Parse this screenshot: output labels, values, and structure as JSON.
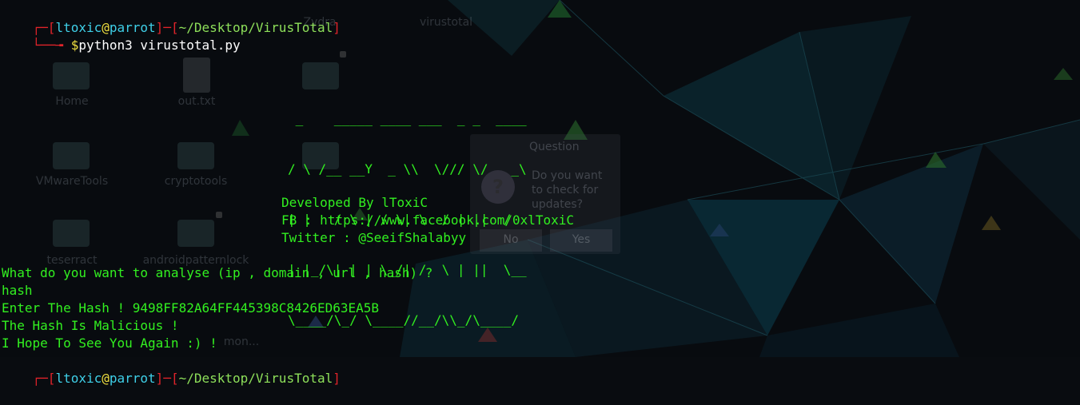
{
  "prompt": {
    "user": "ltoxic",
    "at": "@",
    "host": "parrot",
    "path": "~/Desktop/VirusTotal",
    "symbol": "$",
    "command": "python3 virustotal.py"
  },
  "banner_lines": [
    " _    _____ ____ ___  _ _  ____",
    "/ \\ /__ __Y  _ \\\\  \\/// \\/   _\\",
    "| |   / \\ | / \\| \\  / | ||  /  ",
    "| |_/\\| | | \\_/| /  \\ | ||  \\__",
    "\\____/\\_/ \\____//__/\\\\_/\\____/"
  ],
  "credits": {
    "developer": "Developed By lToxiC",
    "facebook": "FB : https://www.facebook.com/0xlToxiC",
    "twitter": "Twitter : @SeeifShalabyy"
  },
  "session": {
    "question": "What do you want to analyse (ip , domain , url , hash) ?",
    "answer": "hash",
    "hash_prompt": "Enter The Hash ! ",
    "hash_value": "9498FF82A64FF445398C8426ED63EA5B",
    "result": "The Hash Is Malicious !",
    "farewell": "I Hope To See You Again :) !"
  },
  "desktop_icons": {
    "top": [
      "Zydra",
      "virustotal"
    ],
    "home": "Home",
    "out": "out.txt",
    "vmware": "VMwareTools",
    "crypto": "cryptotools",
    "tess": "teserract",
    "android": "androidpatternlock",
    "mon": "mon..."
  },
  "dialog": {
    "title": "Question",
    "text": [
      "Do you want",
      "to check for",
      "updates?"
    ],
    "no": "No",
    "yes": "Yes",
    "icon": "question-icon"
  }
}
